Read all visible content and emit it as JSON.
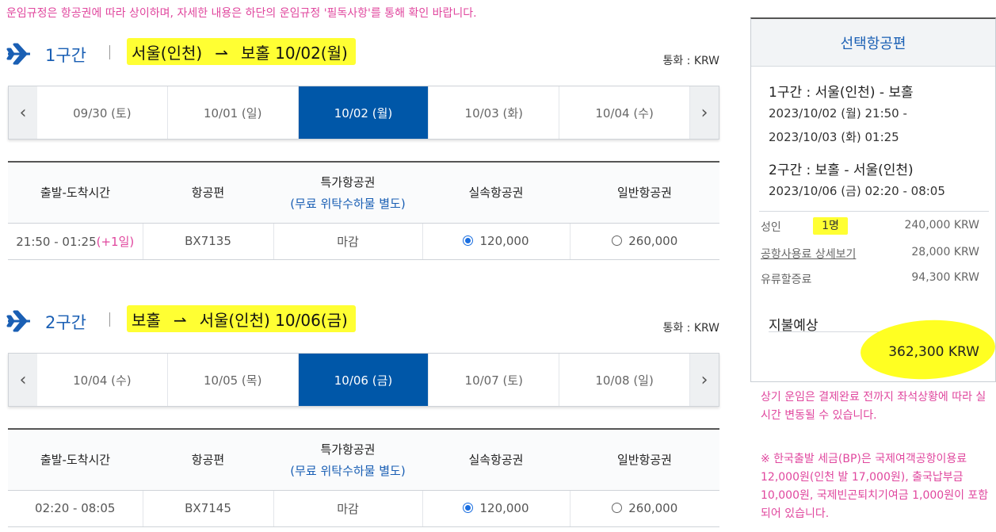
{
  "notice": "운임규정은 항공권에 따라 상이하며, 자세한 내용은 하단의 운임규정 '필독사항'를 통해 확인 바랍니다.",
  "currency_label": "통화 : KRW",
  "columns": {
    "time": "출발-도착시간",
    "flight": "항공편",
    "special": "특가항공권",
    "special_sub": "(무료 위탁수하물 별도)",
    "saver": "실속항공권",
    "normal": "일반항공권"
  },
  "segments": [
    {
      "label": "1구간",
      "from": "서울(인천)",
      "to": "보홀",
      "date": "10/02(월)",
      "prev": "‹",
      "next": "›",
      "dates": [
        "09/30 (토)",
        "10/01 (일)",
        "10/02 (월)",
        "10/03 (화)",
        "10/04 (수)"
      ],
      "active_index": 2,
      "row": {
        "time": "21:50 - 01:25",
        "plus": "(+1일)",
        "flight": "BX7135",
        "special": "마감",
        "saver": "120,000",
        "normal": "260,000",
        "selected": "saver"
      }
    },
    {
      "label": "2구간",
      "from": "보홀",
      "to": "서울(인천)",
      "date": "10/06(금)",
      "prev": "‹",
      "next": "›",
      "dates": [
        "10/04 (수)",
        "10/05 (목)",
        "10/06 (금)",
        "10/07 (토)",
        "10/08 (일)"
      ],
      "active_index": 2,
      "row": {
        "time": "02:20 - 08:05",
        "plus": "",
        "flight": "BX7145",
        "special": "마감",
        "saver": "120,000",
        "normal": "260,000",
        "selected": "saver"
      }
    }
  ],
  "summary": {
    "title": "선택항공편",
    "seg1_title": "1구간 : 서울(인천) - 보홀",
    "seg1_time1": "2023/10/02 (월) 21:50 -",
    "seg1_time2": "2023/10/03 (화) 01:25",
    "seg2_title": "2구간 : 보홀 - 서울(인천)",
    "seg2_time": "2023/10/06 (금) 02:20 - 08:05",
    "adult_label": "성인",
    "adult_count": "1명",
    "adult_fare": "240,000 KRW",
    "airport_fee_label": "공항사용료 상세보기",
    "airport_fee": "28,000 KRW",
    "fuel_label": "유류할증료",
    "fuel_fee": "94,300 KRW",
    "pay_label": "지불예상",
    "total": "362,300 KRW"
  },
  "note1": "상기 운임은 결제완료 전까지 좌석상황에 따라 실시간 변동될 수 있습니다.",
  "note2": "※ 한국출발 세금(BP)은 국제여객공항이용료 12,000원(인천 발 17,000원), 출국납부금 10,000원, 국제빈곤퇴치기여금 1,000원이 포함되어 있습니다.",
  "colors": {
    "accent": "#0057a8",
    "highlight": "#ffff33",
    "notice": "#e0479e"
  }
}
